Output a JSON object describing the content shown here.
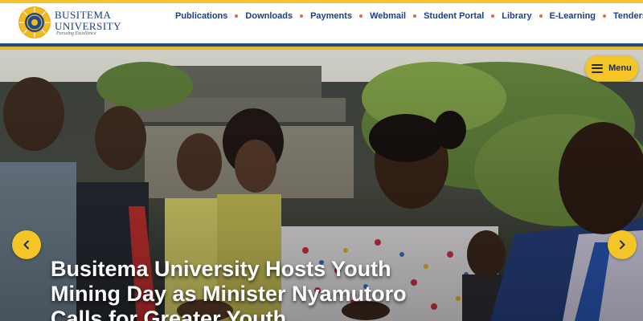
{
  "brand": {
    "name_line1": "BUSITEMA",
    "name_line2": "UNIVERSITY",
    "tagline": "Pursuing Excellence"
  },
  "nav": {
    "items": [
      {
        "label": "Publications"
      },
      {
        "label": "Downloads"
      },
      {
        "label": "Payments"
      },
      {
        "label": "Webmail"
      },
      {
        "label": "Student Portal"
      },
      {
        "label": "Library"
      },
      {
        "label": "E-Learning"
      },
      {
        "label": "Tenders"
      }
    ]
  },
  "menu": {
    "label": "Menu",
    "icon": "hamburger-icon"
  },
  "hero": {
    "headline": "Busitema University Hosts Youth Mining Day as Minister Nyamutoro Calls for Greater Youth...",
    "prev_icon": "chevron-left-icon",
    "next_icon": "chevron-right-icon"
  },
  "colors": {
    "accent_gold": "#f4c526",
    "brand_blue": "#1c3f88",
    "nav_dot": "#e36b3a"
  }
}
